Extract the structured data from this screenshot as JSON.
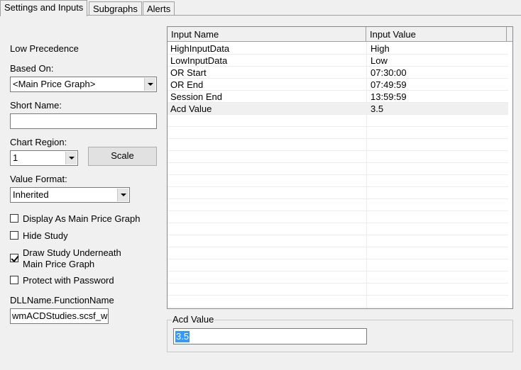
{
  "tabs": [
    {
      "label": "Settings and Inputs",
      "active": true
    },
    {
      "label": "Subgraphs",
      "active": false
    },
    {
      "label": "Alerts",
      "active": false
    }
  ],
  "left": {
    "precedence": "Low Precedence",
    "based_on_label": "Based On:",
    "based_on_value": "<Main Price Graph>",
    "short_name_label": "Short Name:",
    "short_name_value": "",
    "chart_region_label": "Chart Region:",
    "chart_region_value": "1",
    "scale_button": "Scale",
    "value_format_label": "Value Format:",
    "value_format_value": "Inherited",
    "checkboxes": [
      {
        "label": "Display As Main Price Graph",
        "checked": false
      },
      {
        "label": "Hide Study",
        "checked": false
      },
      {
        "label": "Draw Study Underneath",
        "label2": "Main Price Graph",
        "checked": true
      },
      {
        "label": "Protect with Password",
        "checked": false
      }
    ],
    "dll_label": "DLLName.FunctionName",
    "dll_value": "wmACDStudies.scsf_w"
  },
  "grid": {
    "columns": [
      "Input Name",
      "Input Value"
    ],
    "rows": [
      {
        "name": "HighInputData",
        "value": "High"
      },
      {
        "name": "LowInputData",
        "value": "Low"
      },
      {
        "name": "OR Start",
        "value": "07:30:00"
      },
      {
        "name": "OR End",
        "value": "07:49:59"
      },
      {
        "name": "Session End",
        "value": "13:59:59"
      },
      {
        "name": "Acd Value",
        "value": "3.5"
      }
    ]
  },
  "editor": {
    "legend": "Acd Value",
    "value": "3.5"
  }
}
